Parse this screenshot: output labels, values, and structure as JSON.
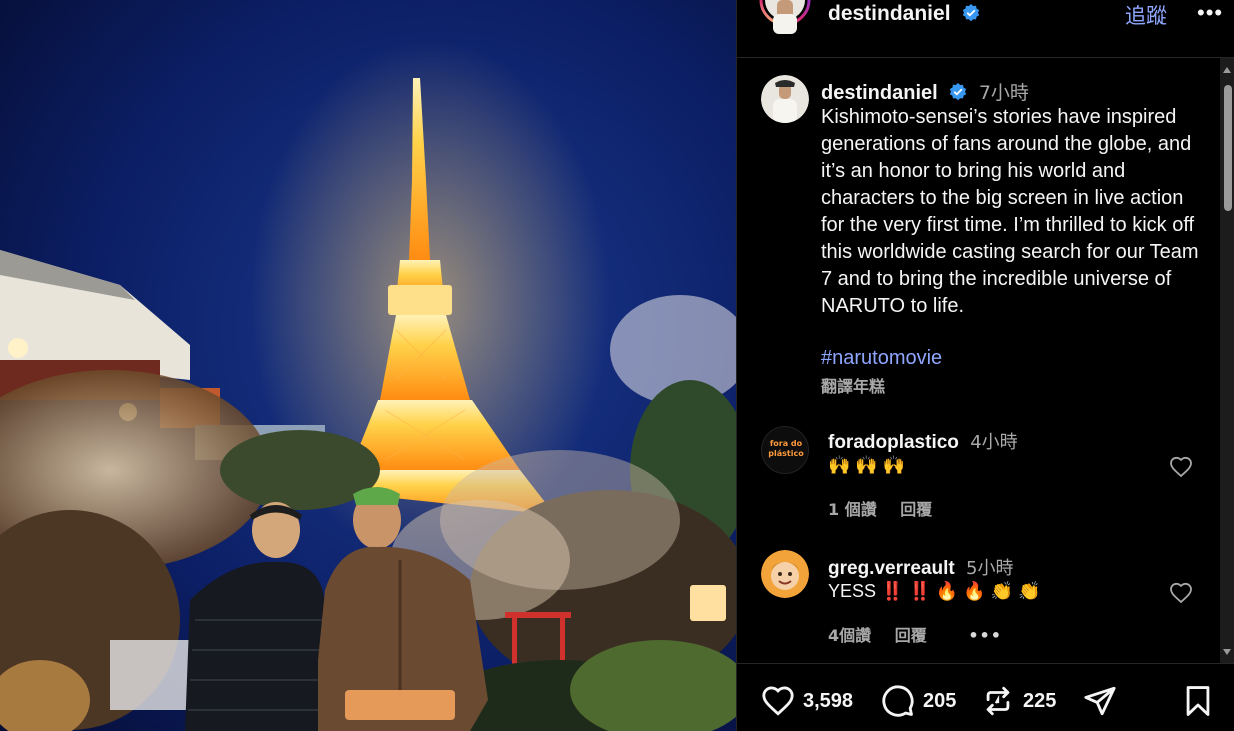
{
  "header": {
    "username": "destindaniel",
    "follow_label": "追蹤",
    "more_label": "•••"
  },
  "caption": {
    "username": "destindaniel",
    "time": "7小時",
    "text": "Kishimoto-sensei’s stories have inspired generations of fans around the globe, and it’s an honor to bring his world and characters to the big screen in live action for the very first time. I’m thrilled to kick off this worldwide casting search for our Team 7 and to bring the incredible universe of NARUTO to life.",
    "hashtag": "#narutomovie",
    "translate_label": "翻譯年糕"
  },
  "comments": [
    {
      "username": "foradoplastico",
      "time": "4小時",
      "text": "🙌 🙌 🙌",
      "likes": "1 個讚",
      "reply": "回覆",
      "avatar_text": "fora do plástico",
      "more": ""
    },
    {
      "username": "greg.verreault",
      "time": "5小時",
      "text": "YESS ‼️ ‼️ 🔥 🔥 👏 👏",
      "likes": "4個讚",
      "reply": "回覆",
      "more": "•••"
    }
  ],
  "actions": {
    "likes": "3,598",
    "comments": "205",
    "reposts": "225"
  },
  "colors": {
    "link": "#8fa6ff",
    "verified": "#3897f0",
    "tower": "#ff9a1f"
  }
}
